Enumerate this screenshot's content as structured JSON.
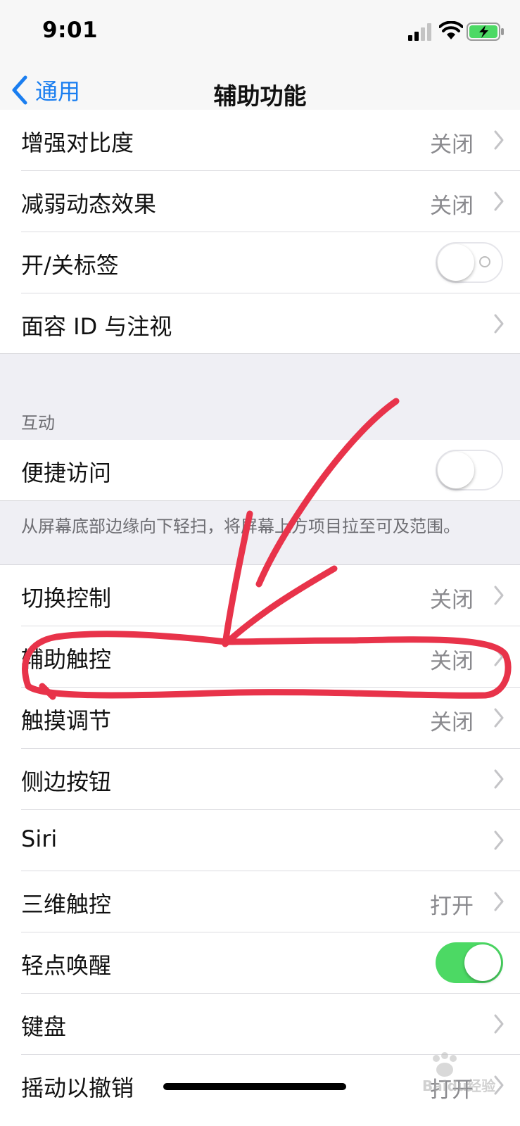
{
  "status": {
    "time": "9:01"
  },
  "nav": {
    "back_label": "通用",
    "title": "辅助功能"
  },
  "vision_rows": [
    {
      "label": "增强对比度",
      "value": "关闭",
      "control": "chevron"
    },
    {
      "label": "减弱动态效果",
      "value": "关闭",
      "control": "chevron"
    },
    {
      "label": "开/关标签",
      "value": "",
      "control": "toggle-off"
    },
    {
      "label": "面容 ID 与注视",
      "value": "",
      "control": "chevron"
    }
  ],
  "interaction": {
    "section_title": "互动",
    "reachability": {
      "label": "便捷访问",
      "state": "off"
    },
    "reachability_footer": "从屏幕底部边缘向下轻扫，将屏幕上方项目拉至可及范围。"
  },
  "interaction_rows": [
    {
      "label": "切换控制",
      "value": "关闭",
      "control": "chevron"
    },
    {
      "label": "辅助触控",
      "value": "关闭",
      "control": "chevron"
    },
    {
      "label": "触摸调节",
      "value": "关闭",
      "control": "chevron"
    },
    {
      "label": "侧边按钮",
      "value": "",
      "control": "chevron"
    },
    {
      "label": "Siri",
      "value": "",
      "control": "chevron"
    },
    {
      "label": "三维触控",
      "value": "打开",
      "control": "chevron"
    },
    {
      "label": "轻点唤醒",
      "value": "",
      "control": "toggle-on"
    },
    {
      "label": "键盘",
      "value": "",
      "control": "chevron"
    },
    {
      "label": "摇动以撤销",
      "value": "打开",
      "control": "chevron"
    }
  ],
  "watermark": {
    "text": "Baidu经验"
  },
  "colors": {
    "accent": "#1a7ef0",
    "toggle_on": "#4cd964",
    "annotation": "#e8334a"
  }
}
